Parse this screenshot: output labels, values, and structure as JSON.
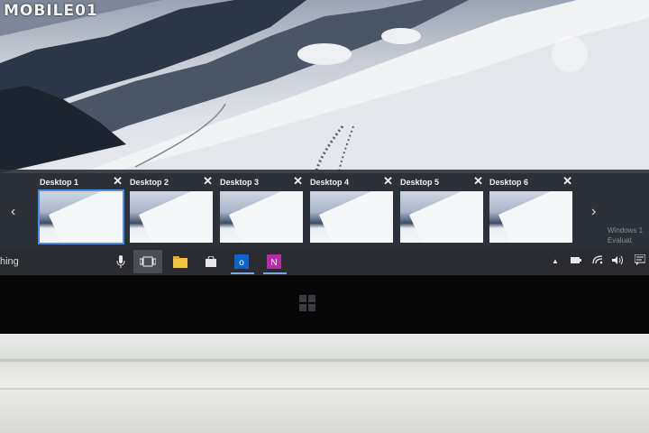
{
  "watermark": {
    "text": "MOBILE01"
  },
  "task_view": {
    "desktops": [
      {
        "label": "Desktop 1",
        "active": true
      },
      {
        "label": "Desktop 2",
        "active": false
      },
      {
        "label": "Desktop 3",
        "active": false
      },
      {
        "label": "Desktop 4",
        "active": false
      },
      {
        "label": "Desktop 5",
        "active": false
      },
      {
        "label": "Desktop 6",
        "active": false
      }
    ],
    "close_glyph": "✕",
    "prev_glyph": "‹",
    "next_glyph": "›"
  },
  "taskbar": {
    "search_text": "hing",
    "icons": [
      "microphone-icon",
      "task-view-icon",
      "file-explorer-icon",
      "store-icon",
      "outlook-icon",
      "onenote-icon"
    ],
    "tray_icons": [
      "chevron-up-icon",
      "battery-icon",
      "wifi-icon",
      "volume-icon",
      "notification-icon"
    ]
  },
  "watermark_text": {
    "line1": "Windows 1",
    "line2": "Evaluat"
  },
  "colors": {
    "accent": "#4a90e2",
    "outlook": "#0f63c8",
    "onenote": "#b72da8",
    "explorer": "#f3c440"
  }
}
